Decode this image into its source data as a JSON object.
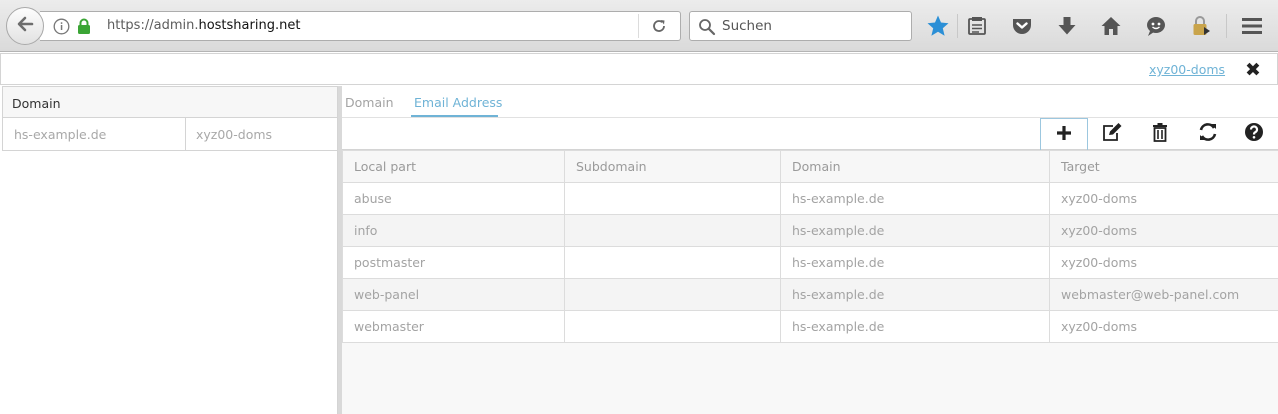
{
  "browser": {
    "url_prefix": "https://admin.",
    "url_host": "hostsharing.net",
    "search_placeholder": "Suchen",
    "icons": [
      "back-arrow-icon",
      "info-icon",
      "lock-icon",
      "reload-icon",
      "search-icon",
      "bookmark-star-icon",
      "reading-list-icon",
      "pocket-icon",
      "download-icon",
      "home-icon",
      "chat-icon",
      "password-manager-icon",
      "hamburger-menu-icon"
    ],
    "accent": "#2b8fd6",
    "lock_color": "#3ba535"
  },
  "header": {
    "user_link": "xyz00-doms",
    "close_label": "✖"
  },
  "left_panel": {
    "column_header": "Domain",
    "rows": [
      {
        "domain": "hs-example.de",
        "owner": "xyz00-doms"
      }
    ]
  },
  "tabs": [
    {
      "label": "Domain",
      "active": false
    },
    {
      "label": "Email Address",
      "active": true
    }
  ],
  "toolbar": {
    "buttons": [
      "add-icon",
      "edit-icon",
      "delete-icon",
      "refresh-icon",
      "help-icon"
    ]
  },
  "table": {
    "columns": [
      "Local part",
      "Subdomain",
      "Domain",
      "Target"
    ],
    "rows": [
      {
        "local_part": "abuse",
        "subdomain": "",
        "domain": "hs-example.de",
        "target": "xyz00-doms"
      },
      {
        "local_part": "info",
        "subdomain": "",
        "domain": "hs-example.de",
        "target": "xyz00-doms"
      },
      {
        "local_part": "postmaster",
        "subdomain": "",
        "domain": "hs-example.de",
        "target": "xyz00-doms"
      },
      {
        "local_part": "web-panel",
        "subdomain": "",
        "domain": "hs-example.de",
        "target": "webmaster@web-panel.com"
      },
      {
        "local_part": "webmaster",
        "subdomain": "",
        "domain": "hs-example.de",
        "target": "xyz00-doms"
      }
    ]
  },
  "colors": {
    "link": "#6fb3d6",
    "muted_text": "#a3a3a3",
    "border": "#d4d4d4"
  }
}
